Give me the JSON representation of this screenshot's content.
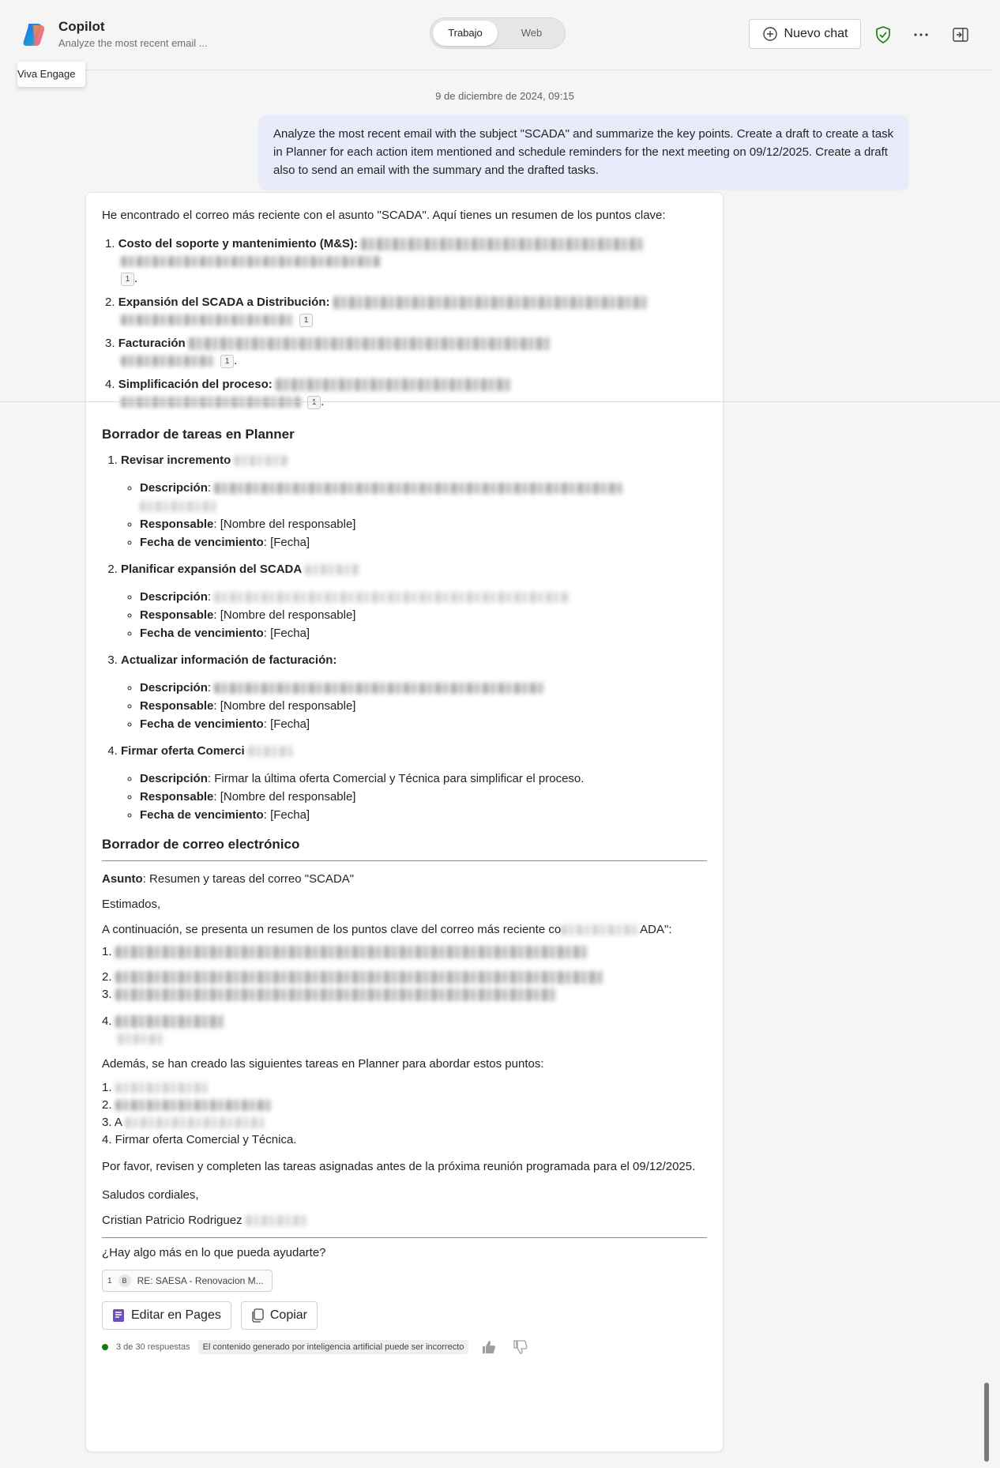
{
  "header": {
    "app_title": "Copilot",
    "subtitle": "Analyze the most recent email ...",
    "toggle": {
      "active": "Trabajo",
      "inactive": "Web"
    },
    "new_chat": "Nuevo chat",
    "icons": [
      "copilot-logo-icon",
      "shield-check-icon",
      "more-options-icon",
      "panel-toggle-icon"
    ],
    "tooltip": "Viva Engage"
  },
  "conversation": {
    "timestamp": "9 de diciembre de 2024, 09:15",
    "user_message": "Analyze the most recent email with the subject \"SCADA\" and summarize the key points. Create a draft to create a task in Planner for each action item mentioned and schedule reminders for the next meeting on 09/12/2025. Create a draft also to send an email with the summary and the drafted tasks."
  },
  "response": {
    "intro": "He encontrado el correo más reciente con el asunto \"SCADA\". Aquí tienes un resumen de los puntos clave:",
    "key_points": [
      {
        "num": "1.",
        "title": "Costo del soporte y mantenimiento (M&S):",
        "cite": "1"
      },
      {
        "num": "2.",
        "title": "Expansión del SCADA a Distribución:",
        "cite": "1"
      },
      {
        "num": "3.",
        "title": "Facturación",
        "cite": "1"
      },
      {
        "num": "4.",
        "title": "Simplificación del proceso:",
        "cite": "1"
      }
    ],
    "planner_heading": "Borrador de tareas en Planner",
    "tasks": [
      {
        "title": "Revisar incremento",
        "description_label": "Descripción",
        "description": "",
        "owner_label": "Responsable",
        "owner": "[Nombre del responsable]",
        "due_label": "Fecha de vencimiento",
        "due": "[Fecha]"
      },
      {
        "title": "Planificar expansión del SCADA",
        "description_label": "Descripción",
        "description": "",
        "owner_label": "Responsable",
        "owner": "[Nombre del responsable]",
        "due_label": "Fecha de vencimiento",
        "due": "[Fecha]"
      },
      {
        "title": "Actualizar información de facturación:",
        "description_label": "Descripción",
        "description": "",
        "owner_label": "Responsable",
        "owner": "[Nombre del responsable]",
        "due_label": "Fecha de vencimiento",
        "due": "[Fecha]"
      },
      {
        "title": "Firmar oferta Comerci",
        "description_label": "Descripción",
        "description": "Firmar la última oferta Comercial y Técnica para simplificar el proceso.",
        "owner_label": "Responsable",
        "owner": "[Nombre del responsable]",
        "due_label": "Fecha de vencimiento",
        "due": "[Fecha]"
      }
    ],
    "email_heading": "Borrador de correo electrónico",
    "email": {
      "subject_label": "Asunto",
      "subject": "Resumen y tareas del correo \"SCADA\"",
      "greeting": "Estimados,",
      "intro": "A continuación, se presenta un resumen de los puntos clave del correo más reciente co",
      "intro_tail": "ADA\":",
      "points": [
        "1.",
        "2.",
        "3.",
        "4."
      ],
      "tasks_intro": "Además, se han creado las siguientes tareas en Planner para abordar estos puntos:",
      "task_list": [
        "1.",
        "2.",
        "3. A",
        "4. Firmar oferta Comercial y Técnica."
      ],
      "closing_request": "Por favor, revisen y completen las tareas asignadas antes de la próxima reunión programada para el 09/12/2025.",
      "signoff": "Saludos cordiales,",
      "signature": "Cristian Patricio Rodriguez"
    },
    "followup": "¿Hay algo más en lo que pueda ayudarte?",
    "reference": {
      "num": "1",
      "badge": "B",
      "label": "RE: SAESA - Renovacion M..."
    },
    "buttons": {
      "edit_pages": "Editar en Pages",
      "copy": "Copiar"
    },
    "footer": {
      "responses": "3 de 30 respuestas",
      "disclaimer": "El contenido generado por inteligencia artificial puede ser incorrecto"
    }
  },
  "colors": {
    "user_bubble": "#e8ebfa",
    "status_green": "#107c10",
    "shield_green": "#107c10",
    "pages_purple": "#6b4fbb"
  }
}
